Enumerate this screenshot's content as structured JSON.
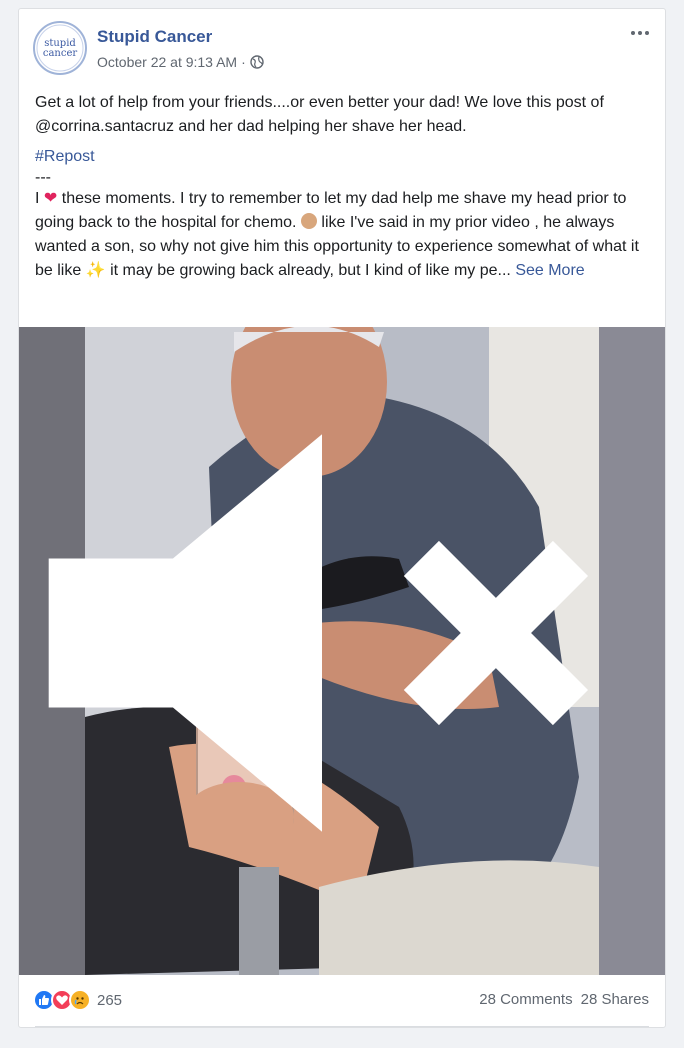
{
  "post": {
    "page_name": "Stupid Cancer",
    "avatar_text_line1": "stupid",
    "avatar_text_line2": "cancer",
    "timestamp": "October 22 at 9:13 AM",
    "separator": "·",
    "text_intro": "Get a lot of help from your friends....or even better your dad! We love this post of @corrina.santacruz and her dad helping her shave her head.",
    "hashtag": "#Repost",
    "dashes": "---",
    "body_part1": "I",
    "body_part2": "these moments. I try to remember to let my dad help me shave my head prior to going back to the hospital for chemo.",
    "body_part3": "like I've said in my prior video , he always wanted a son, so why not give him this opportunity to experience somewhat of what it be like",
    "body_part4": "it may be growing back already, but I kind of like my pe...",
    "see_more": "See More"
  },
  "footer": {
    "reaction_count": "265",
    "comments": "28 Comments",
    "shares": "28 Shares"
  },
  "icons": {
    "heart": "❤",
    "sparkle": "✨"
  },
  "colors": {
    "link_blue": "#385898",
    "like_blue": "#2078f4",
    "love_red": "#f33e58",
    "sad_yellow": "#f7b125"
  }
}
